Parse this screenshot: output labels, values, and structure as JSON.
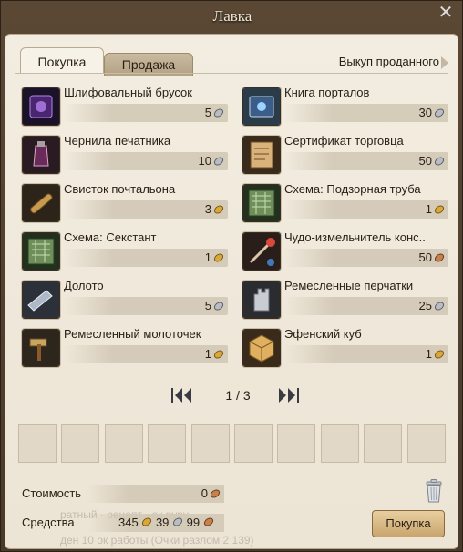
{
  "window": {
    "title": "Лавка"
  },
  "tabs": {
    "buy": "Покупка",
    "sell": "Продажа",
    "buyback": "Выкуп проданного"
  },
  "items": [
    {
      "name": "Шлифовальный брусок",
      "price": "5",
      "currency": "silver",
      "icon": "whetstone-icon"
    },
    {
      "name": "Книга порталов",
      "price": "30",
      "currency": "silver",
      "icon": "portal-book-icon"
    },
    {
      "name": "Чернила печатника",
      "price": "10",
      "currency": "silver",
      "icon": "ink-icon"
    },
    {
      "name": "Сертификат торговца",
      "price": "50",
      "currency": "silver",
      "icon": "certificate-icon"
    },
    {
      "name": "Свисток почтальона",
      "price": "3",
      "currency": "gold",
      "icon": "whistle-icon"
    },
    {
      "name": "Схема: Подзорная труба",
      "price": "1",
      "currency": "gold",
      "icon": "schematic-icon"
    },
    {
      "name": "Схема: Секстант",
      "price": "1",
      "currency": "gold",
      "icon": "schematic-icon"
    },
    {
      "name": "Чудо-измельчитель конс..",
      "price": "50",
      "currency": "copper",
      "icon": "grinder-icon"
    },
    {
      "name": "Долото",
      "price": "5",
      "currency": "silver",
      "icon": "chisel-icon"
    },
    {
      "name": "Ремесленные перчатки",
      "price": "25",
      "currency": "silver",
      "icon": "gloves-icon"
    },
    {
      "name": "Ремесленный молоточек",
      "price": "1",
      "currency": "gold",
      "icon": "hammer-icon"
    },
    {
      "name": "Эфенский куб",
      "price": "1",
      "currency": "gold",
      "icon": "cube-icon"
    }
  ],
  "pagination": {
    "current": "1",
    "separator": "/",
    "total": "3",
    "text": "1 / 3"
  },
  "cost": {
    "label": "Стоимость",
    "value": "0",
    "currency": "copper"
  },
  "funds": {
    "label": "Средства",
    "gold": "345",
    "silver": "39",
    "copper": "99"
  },
  "buttons": {
    "buy": "Покупка"
  },
  "colors": {
    "gold": "#d9a73a",
    "silver": "#b9bcc2",
    "copper": "#c8814a",
    "panel": "#efe8da"
  }
}
